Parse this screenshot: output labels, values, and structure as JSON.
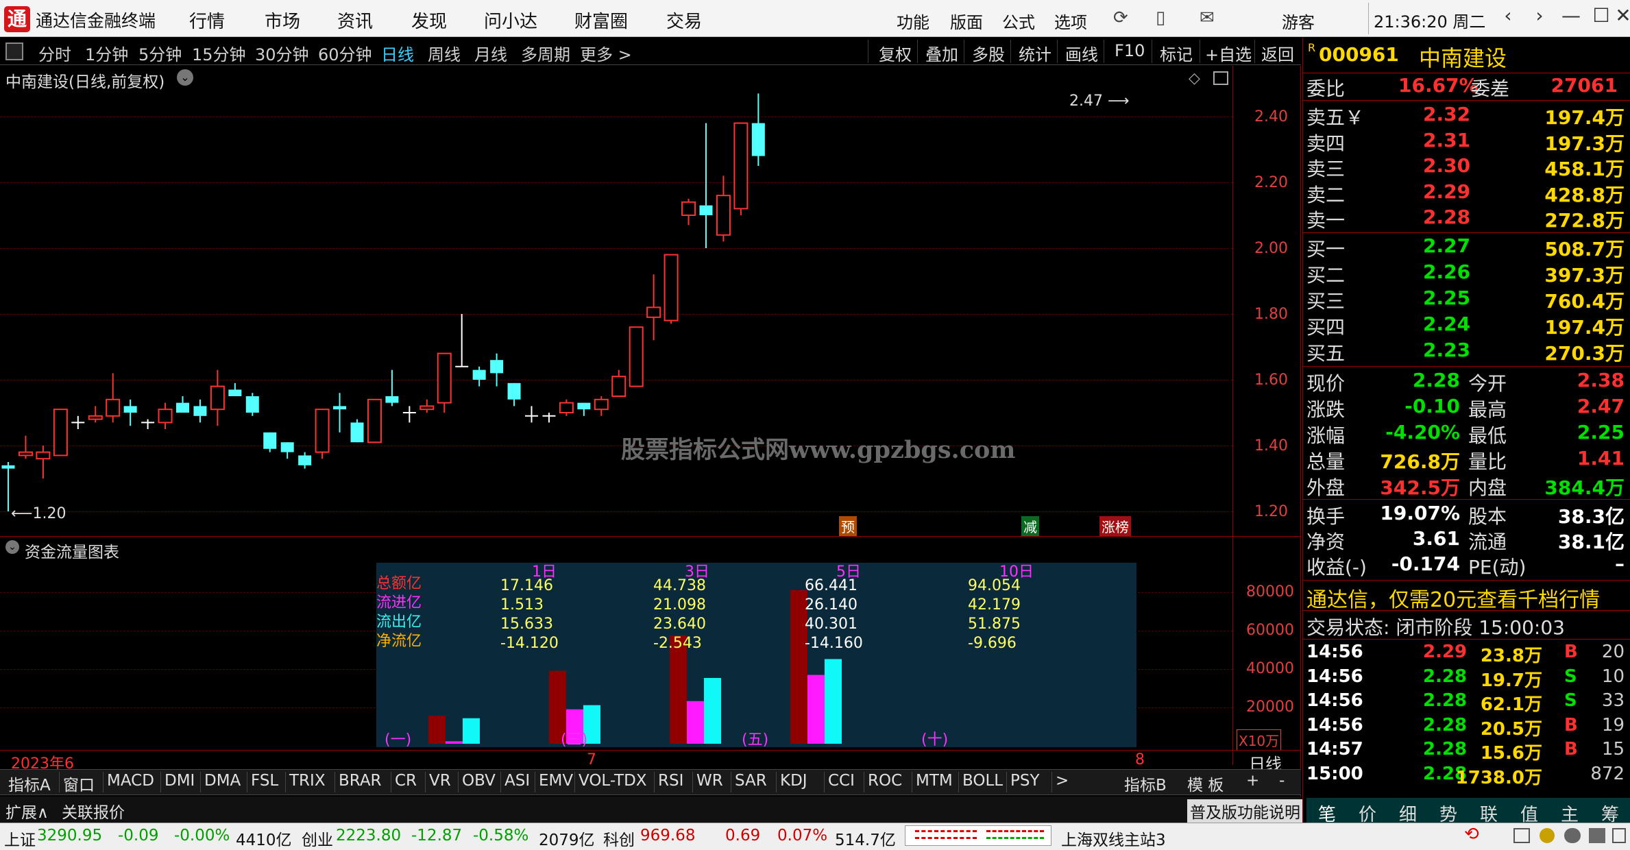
{
  "app": {
    "title": "通达信金融终端",
    "logo_glyph": "通",
    "menus": [
      "行情",
      "市场",
      "资讯",
      "发现",
      "问小达",
      "财富圈",
      "交易"
    ],
    "right_menus": [
      "功能",
      "版面",
      "公式",
      "选项"
    ],
    "user": "游客",
    "clock": "21:36:20 周二",
    "win_buttons": [
      "‹",
      "›",
      "—",
      "☐",
      "✕"
    ]
  },
  "toolbar": {
    "periods": [
      "分时",
      "1分钟",
      "5分钟",
      "15分钟",
      "30分钟",
      "60分钟",
      "日线",
      "周线",
      "月线",
      "多周期",
      "更多 >"
    ],
    "active": "日线",
    "right": [
      "复权",
      "叠加",
      "多股",
      "统计",
      "画线",
      "F10",
      "标记",
      "+自选",
      "返回"
    ]
  },
  "chart": {
    "title": "中南建设(日线,前复权)",
    "watermark": "股票指标公式网www.gpzbgs.com",
    "high_label": "2.47",
    "low_label": "1.20",
    "y_ticks": [
      "2.40",
      "2.20",
      "2.00",
      "1.80",
      "1.60",
      "1.40",
      "1.20"
    ],
    "markers": [
      "预",
      "减",
      "涨榜"
    ],
    "x_labels": [
      "2023年6",
      "7",
      "8"
    ],
    "period_label": "日线"
  },
  "flow": {
    "title": "资金流量图表",
    "y_ticks": [
      "80000",
      "60000",
      "40000",
      "20000"
    ],
    "unit": "X10万",
    "row_labels": [
      "总额亿",
      "流进亿",
      "流出亿",
      "净流亿"
    ],
    "columns": [
      {
        "label": "1日",
        "values": [
          "17.146",
          "1.513",
          "15.633",
          "-14.120"
        ],
        "tag": "(一)"
      },
      {
        "label": "3日",
        "values": [
          "44.738",
          "21.098",
          "23.640",
          "-2.543"
        ],
        "tag": "(三)"
      },
      {
        "label": "5日",
        "values": [
          "66.441",
          "26.140",
          "40.301",
          "-14.160"
        ],
        "tag": "(五)"
      },
      {
        "label": "10日",
        "values": [
          "94.054",
          "42.179",
          "51.875",
          "-9.696"
        ],
        "tag": "(十)"
      }
    ]
  },
  "chart_data": [
    {
      "type": "candlestick",
      "title": "中南建设(日线,前复权)",
      "ylim": [
        1.13,
        2.5
      ],
      "x_labels": [
        "2023年6",
        "7",
        "8"
      ],
      "candles": [
        [
          1.34,
          1.33,
          1.35,
          1.2
        ],
        [
          1.37,
          1.38,
          1.43,
          1.36
        ],
        [
          1.36,
          1.38,
          1.4,
          1.3
        ],
        [
          1.37,
          1.51,
          1.51,
          1.37
        ],
        [
          1.47,
          1.47,
          1.49,
          1.45
        ],
        [
          1.48,
          1.49,
          1.52,
          1.47
        ],
        [
          1.49,
          1.54,
          1.62,
          1.47
        ],
        [
          1.52,
          1.5,
          1.54,
          1.46
        ],
        [
          1.47,
          1.47,
          1.48,
          1.45
        ],
        [
          1.47,
          1.51,
          1.53,
          1.45
        ],
        [
          1.53,
          1.5,
          1.55,
          1.5
        ],
        [
          1.52,
          1.49,
          1.54,
          1.47
        ],
        [
          1.51,
          1.58,
          1.63,
          1.46
        ],
        [
          1.57,
          1.55,
          1.59,
          1.55
        ],
        [
          1.55,
          1.5,
          1.56,
          1.49
        ],
        [
          1.44,
          1.39,
          1.44,
          1.38
        ],
        [
          1.41,
          1.38,
          1.41,
          1.36
        ],
        [
          1.37,
          1.34,
          1.38,
          1.33
        ],
        [
          1.38,
          1.51,
          1.51,
          1.36
        ],
        [
          1.52,
          1.51,
          1.56,
          1.44
        ],
        [
          1.47,
          1.41,
          1.48,
          1.41
        ],
        [
          1.41,
          1.54,
          1.54,
          1.41
        ],
        [
          1.55,
          1.53,
          1.63,
          1.52
        ],
        [
          1.5,
          1.5,
          1.52,
          1.47
        ],
        [
          1.51,
          1.52,
          1.54,
          1.5
        ],
        [
          1.53,
          1.68,
          1.68,
          1.5
        ],
        [
          1.64,
          1.64,
          1.8,
          1.64
        ],
        [
          1.63,
          1.6,
          1.64,
          1.58
        ],
        [
          1.66,
          1.62,
          1.68,
          1.58
        ],
        [
          1.59,
          1.54,
          1.59,
          1.52
        ],
        [
          1.49,
          1.49,
          1.52,
          1.47
        ],
        [
          1.49,
          1.49,
          1.5,
          1.47
        ],
        [
          1.5,
          1.53,
          1.54,
          1.49
        ],
        [
          1.53,
          1.51,
          1.53,
          1.49
        ],
        [
          1.51,
          1.54,
          1.55,
          1.49
        ],
        [
          1.55,
          1.61,
          1.63,
          1.55
        ],
        [
          1.58,
          1.76,
          1.76,
          1.58
        ],
        [
          1.79,
          1.82,
          1.92,
          1.72
        ],
        [
          1.78,
          1.98,
          1.98,
          1.77
        ],
        [
          2.1,
          2.14,
          2.15,
          2.07
        ],
        [
          2.13,
          2.1,
          2.38,
          2.0
        ],
        [
          2.04,
          2.16,
          2.22,
          2.02
        ],
        [
          2.12,
          2.38,
          2.38,
          2.1
        ],
        [
          2.38,
          2.28,
          2.47,
          2.25
        ]
      ]
    },
    {
      "type": "bar",
      "title": "资金流量图表",
      "categories": [
        "1日",
        "3日",
        "5日",
        "10日"
      ],
      "series": [
        {
          "name": "总额亿",
          "values": [
            17.146,
            44.738,
            66.441,
            94.054
          ]
        },
        {
          "name": "流进亿",
          "values": [
            1.513,
            21.098,
            26.14,
            42.179
          ]
        },
        {
          "name": "流出亿",
          "values": [
            15.633,
            23.64,
            40.301,
            51.875
          ]
        },
        {
          "name": "净流亿",
          "values": [
            -14.12,
            -2.543,
            -14.16,
            -9.696
          ]
        }
      ],
      "ylim": [
        0,
        94054
      ],
      "y_ticks": [
        "80000",
        "60000",
        "40000",
        "20000"
      ],
      "unit": "X10万"
    }
  ],
  "quote": {
    "code": "000961",
    "name": "中南建设",
    "code_prefix": "R",
    "weibi_label": "委比",
    "weibi": "16.67%",
    "weicha_label": "委差",
    "weicha": "27061",
    "asks": [
      {
        "label": "卖五￥",
        "price": "2.32",
        "vol": "197.4万"
      },
      {
        "label": "卖四",
        "price": "2.31",
        "vol": "197.3万"
      },
      {
        "label": "卖三",
        "price": "2.30",
        "vol": "458.1万"
      },
      {
        "label": "卖二",
        "price": "2.29",
        "vol": "428.8万"
      },
      {
        "label": "卖一",
        "price": "2.28",
        "vol": "272.8万"
      }
    ],
    "bids": [
      {
        "label": "买一",
        "price": "2.27",
        "vol": "508.7万"
      },
      {
        "label": "买二",
        "price": "2.26",
        "vol": "397.3万"
      },
      {
        "label": "买三",
        "price": "2.25",
        "vol": "760.4万"
      },
      {
        "label": "买四",
        "price": "2.24",
        "vol": "197.4万"
      },
      {
        "label": "买五",
        "price": "2.23",
        "vol": "270.3万"
      }
    ],
    "stats": [
      [
        "现价",
        "2.28",
        "今开",
        "2.38"
      ],
      [
        "涨跌",
        "-0.10",
        "最高",
        "2.47"
      ],
      [
        "涨幅",
        "-4.20%",
        "最低",
        "2.25"
      ],
      [
        "总量",
        "726.8万",
        "量比",
        "1.41"
      ],
      [
        "外盘",
        "342.5万",
        "内盘",
        "384.4万"
      ]
    ],
    "stats2": [
      [
        "换手",
        "19.07%",
        "股本",
        "38.3亿"
      ],
      [
        "净资",
        "3.61",
        "流通",
        "38.1亿"
      ],
      [
        "收益(-)",
        "-0.174",
        "PE(动)",
        "–"
      ]
    ],
    "promo": "通达信，仅需20元查看千档行情",
    "status": "交易状态: 闭市阶段 15:00:03",
    "ticks": [
      [
        "14:56",
        "2.29",
        "23.8万",
        "B",
        "20"
      ],
      [
        "14:56",
        "2.28",
        "19.7万",
        "S",
        "10"
      ],
      [
        "14:56",
        "2.28",
        "62.1万",
        "S",
        "33"
      ],
      [
        "14:56",
        "2.28",
        "20.5万",
        "B",
        "19"
      ],
      [
        "14:57",
        "2.28",
        "15.6万",
        "B",
        "15"
      ],
      [
        "15:00",
        "2.28",
        "1738.0万",
        "",
        "872"
      ]
    ],
    "tabs": [
      "笔",
      "价",
      "细",
      "势",
      "联",
      "值",
      "主",
      "筹"
    ]
  },
  "bottom": {
    "indicators": [
      "指标A",
      "窗口",
      "MACD",
      "DMI",
      "DMA",
      "FSL",
      "TRIX",
      "BRAR",
      "CR",
      "VR",
      "OBV",
      "ASI",
      "EMV",
      "VOL-TDX",
      "RSI",
      "WR",
      "SAR",
      "KDJ",
      "CCI",
      "ROC",
      "MTM",
      "BOLL",
      "PSY",
      ">"
    ],
    "right": [
      "指标B",
      "模 板",
      "+",
      "-"
    ],
    "row2_left": [
      "扩展∧",
      "关联报价"
    ],
    "row2_right": "普及版功能说明"
  },
  "statusbar": {
    "sh_label": "上证",
    "sh_val": "3290.95",
    "sh_chg": "-0.09",
    "sh_pct": "-0.00%",
    "sh_amt": "4410亿",
    "cy_label": "创业",
    "cy_val": "2223.80",
    "cy_chg": "-12.87",
    "cy_pct": "-0.58%",
    "cy_amt": "2079亿",
    "kc_label": "科创",
    "kc_val": "969.68",
    "kc_chg": "0.69",
    "kc_pct": "0.07%",
    "kc_amt": "514.7亿",
    "server": "上海双线主站3"
  }
}
